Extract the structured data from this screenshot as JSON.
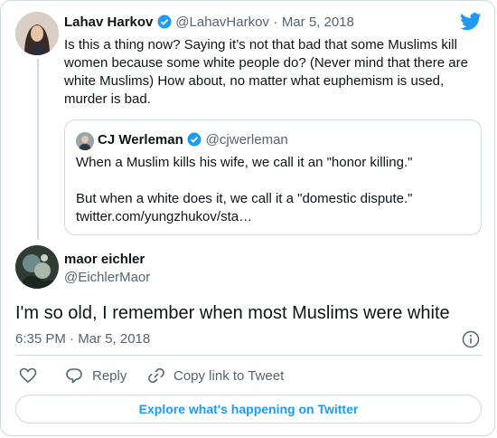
{
  "parent_tweet": {
    "author_name": "Lahav Harkov",
    "author_handle": "@LahavHarkov",
    "separator": "·",
    "date": "Mar 5, 2018",
    "text": "Is this a thing now? Saying it’s not that bad that some Muslims kill women because some white people do? (Never mind that there are white Muslims) How about, no matter what euphemism is used, murder is bad."
  },
  "quoted_tweet": {
    "author_name": "CJ Werleman",
    "author_handle": "@cjwerleman",
    "line1": "When a Muslim kills his wife, we call it an \"honor killing.\"",
    "line2": "But when a white does it, we call it a \"domestic dispute.\"",
    "link": "twitter.com/yungzhukov/sta…"
  },
  "main_tweet": {
    "author_name": "maor eichler",
    "author_handle": "@EichlerMaor",
    "text": "I'm so old, I remember when most Muslims were white",
    "timestamp": "6:35 PM · Mar 5, 2018"
  },
  "actions": {
    "reply_label": "Reply",
    "copy_link_label": "Copy link to Tweet"
  },
  "cta_label": "Explore what's happening on Twitter",
  "colors": {
    "accent": "#1d9bf0",
    "text": "#0f1419",
    "muted": "#536471",
    "border": "#cfd9de"
  }
}
